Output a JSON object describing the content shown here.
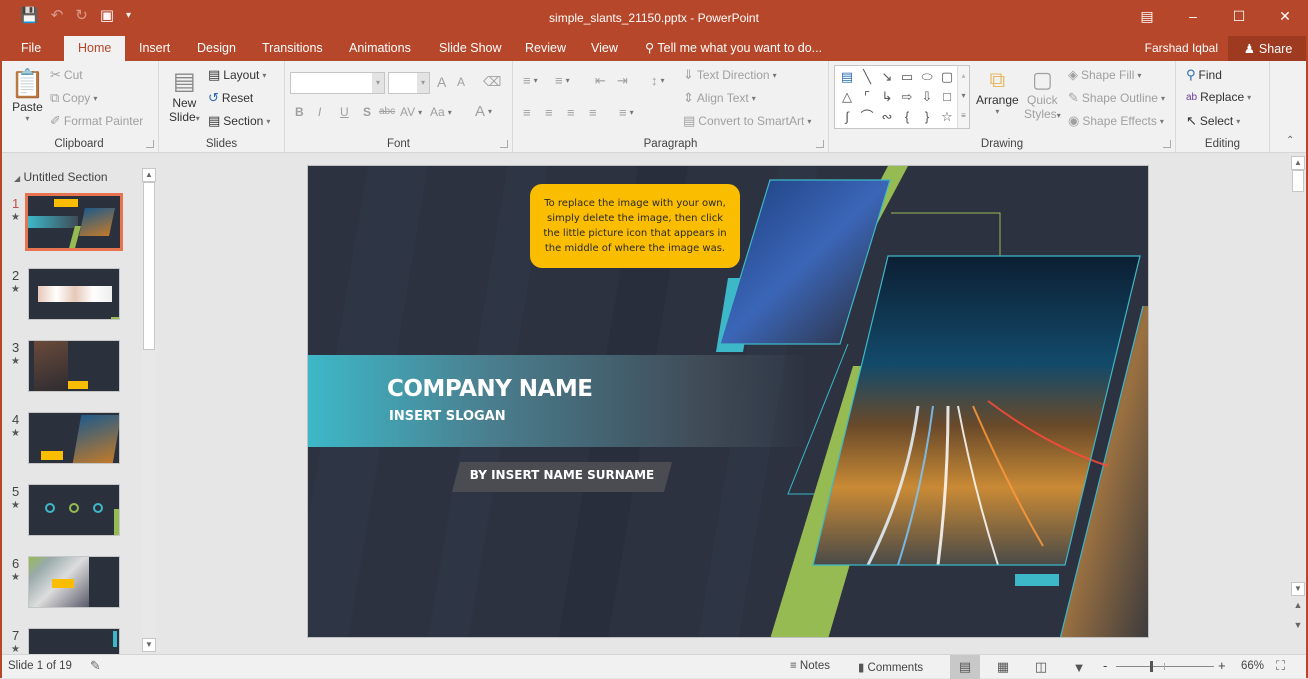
{
  "window": {
    "title": "simple_slants_21150.pptx - PowerPoint",
    "controls": [
      "ribbon-display-options",
      "minimize",
      "maximize",
      "close"
    ]
  },
  "quick_access": {
    "save_icon": "save-icon",
    "undo_icon": "undo-icon",
    "redo_icon": "redo-icon",
    "present_icon": "start-from-beginning-icon",
    "customize_icon": "customize-qat-icon"
  },
  "tabs": [
    "File",
    "Home",
    "Insert",
    "Design",
    "Transitions",
    "Animations",
    "Slide Show",
    "Review",
    "View"
  ],
  "active_tab": "Home",
  "tell_me": "Tell me what you want to do...",
  "user": "Farshad Iqbal",
  "share_label": "Share",
  "ribbon": {
    "clipboard": {
      "label": "Clipboard",
      "paste": "Paste",
      "cut": "Cut",
      "copy": "Copy",
      "format_painter": "Format Painter"
    },
    "slides": {
      "label": "Slides",
      "new_slide_1": "New",
      "new_slide_2": "Slide",
      "layout": "Layout",
      "reset": "Reset",
      "section": "Section"
    },
    "font": {
      "label": "Font",
      "font_name": "",
      "font_size": "",
      "bold": "B",
      "italic": "I",
      "underline": "U",
      "shadow": "S",
      "strike": "abc",
      "spacing": "AV",
      "case": "Aa",
      "color": "A",
      "grow": "A",
      "shrink": "A"
    },
    "paragraph": {
      "label": "Paragraph",
      "text_direction": "Text Direction",
      "align_text": "Align Text",
      "smartart": "Convert to SmartArt"
    },
    "drawing": {
      "label": "Drawing",
      "arrange": "Arrange",
      "quick_styles_1": "Quick",
      "quick_styles_2": "Styles",
      "shape_fill": "Shape Fill",
      "shape_outline": "Shape Outline",
      "shape_effects": "Shape Effects"
    },
    "editing": {
      "label": "Editing",
      "find": "Find",
      "replace": "Replace",
      "select": "Select"
    }
  },
  "slide_panel": {
    "section": "Untitled Section",
    "slides": [
      {
        "num": "1",
        "selected": true
      },
      {
        "num": "2",
        "selected": false
      },
      {
        "num": "3",
        "selected": false
      },
      {
        "num": "4",
        "selected": false
      },
      {
        "num": "5",
        "selected": false
      },
      {
        "num": "6",
        "selected": false
      },
      {
        "num": "7",
        "selected": false
      }
    ]
  },
  "slide": {
    "callout": "To replace the image with your own, simply delete the image, then click the little picture icon that appears in the middle of where the image was.",
    "company": "COMPANY NAME",
    "slogan": "INSERT SLOGAN",
    "byline": "BY INSERT NAME SURNAME",
    "colors": {
      "background": "#2c3240",
      "accent_teal": "#3db8c8",
      "accent_green": "#96bb52",
      "callout": "#fbbd00"
    }
  },
  "status": {
    "slide_info": "Slide 1 of 19",
    "notes": "Notes",
    "comments": "Comments",
    "zoom": "66%",
    "zoom_fraction": 0.36
  }
}
